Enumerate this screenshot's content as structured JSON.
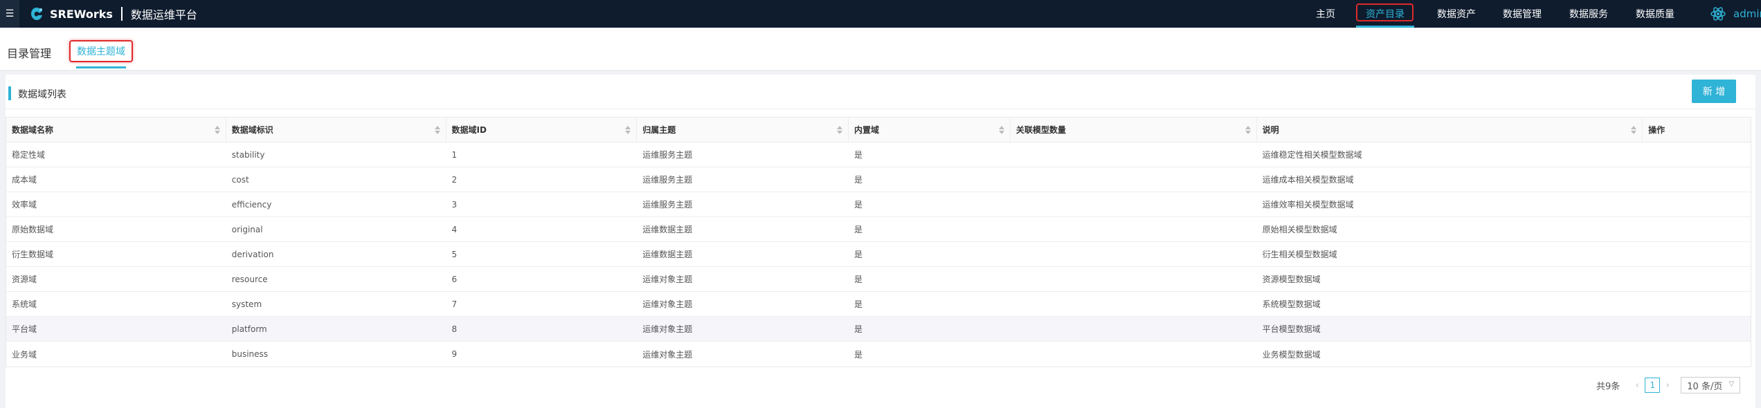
{
  "header": {
    "brand_name": "SREWorks",
    "brand_subtitle": "数据运维平台",
    "menu_icon": "menu-icon",
    "nav": [
      {
        "label": "主页"
      },
      {
        "label": "资产目录"
      },
      {
        "label": "数据资产"
      },
      {
        "label": "数据管理"
      },
      {
        "label": "数据服务"
      },
      {
        "label": "数据质量"
      }
    ],
    "user": "admin"
  },
  "subheader": {
    "title": "目录管理",
    "active_tab": "数据主题域"
  },
  "panel": {
    "title": "数据域列表",
    "new_button": "新 增"
  },
  "table": {
    "columns": [
      "数据域名称",
      "数据域标识",
      "数据域ID",
      "归属主题",
      "内置域",
      "关联模型数量",
      "说明",
      "操作"
    ],
    "rows": [
      [
        "稳定性域",
        "stability",
        "1",
        "运维服务主题",
        "是",
        "",
        "运维稳定性相关模型数据域"
      ],
      [
        "成本域",
        "cost",
        "2",
        "运维服务主题",
        "是",
        "",
        "运维成本相关模型数据域"
      ],
      [
        "效率域",
        "efficiency",
        "3",
        "运维服务主题",
        "是",
        "",
        "运维效率相关模型数据域"
      ],
      [
        "原始数据域",
        "original",
        "4",
        "运维数据主题",
        "是",
        "",
        "原始相关模型数据域"
      ],
      [
        "衍生数据域",
        "derivation",
        "5",
        "运维数据主题",
        "是",
        "",
        "衍生相关模型数据域"
      ],
      [
        "资源域",
        "resource",
        "6",
        "运维对象主题",
        "是",
        "",
        "资源模型数据域"
      ],
      [
        "系统域",
        "system",
        "7",
        "运维对象主题",
        "是",
        "",
        "系统模型数据域"
      ],
      [
        "平台域",
        "platform",
        "8",
        "运维对象主题",
        "是",
        "",
        "平台模型数据域"
      ],
      [
        "业务域",
        "business",
        "9",
        "运维对象主题",
        "是",
        "",
        "业务模型数据域"
      ]
    ]
  },
  "pagination": {
    "total": "共9条",
    "current": "1",
    "page_size": "10 条/页"
  },
  "colors": {
    "accent": "#2fb3d6",
    "topbar": "#0f1c2e",
    "highlight": "#e02a2a"
  }
}
